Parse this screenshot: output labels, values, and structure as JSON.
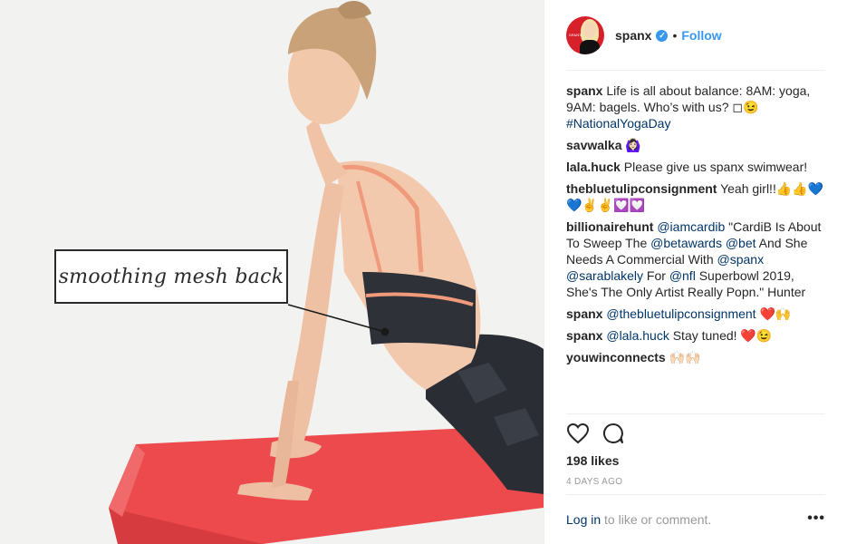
{
  "photo": {
    "callout_text": "smoothing mesh back"
  },
  "header": {
    "username": "spanx",
    "verified_icon": "verified-badge-icon",
    "separator": "•",
    "follow_label": "Follow",
    "avatar_brand": "SPANX"
  },
  "caption": {
    "username": "spanx",
    "text": " Life is all about balance: 8AM: yoga, 9AM: bagels. Who’s with us? ◻😉 ",
    "hashtag": "#NationalYogaDay"
  },
  "comments": [
    {
      "user": "savwalka",
      "parts": [
        " 🙆🏻‍♀️"
      ]
    },
    {
      "user": "lala.huck",
      "parts": [
        " Please give us spanx swimwear!"
      ]
    },
    {
      "user": "thebluetulipconsignment",
      "parts": [
        " Yeah girl!!👍👍💙💙✌✌💟💟"
      ]
    },
    {
      "user": "billionairehunt",
      "mention1": "@iamcardib",
      "t1": " \"CardiB Is About To Sweep The ",
      "mention2": "@betawards",
      "t2": " ",
      "mention3": "@bet",
      "t3": " And She Needs A Commercial With ",
      "mention4": "@spanx",
      "t4": " ",
      "mention5": "@sarablakely",
      "t5": " For ",
      "mention6": "@nfl",
      "t6": " Superbowl 2019, She's The Only Artist Really Popn.\" Hunter"
    },
    {
      "user": "spanx",
      "mention": "@thebluetulipconsignment",
      "text": " ❤️🙌"
    },
    {
      "user": "spanx",
      "mention": "@lala.huck",
      "text": " Stay tuned! ❤️😉"
    },
    {
      "user": "youwinconnects",
      "text": " 🙌🏻🙌🏻"
    }
  ],
  "actions": {
    "like_icon": "heart-icon",
    "comment_icon": "comment-icon"
  },
  "likes": "198 likes",
  "time_ago": "4 DAYS AGO",
  "footer": {
    "login_link": "Log in",
    "login_text": " to like or comment.",
    "more": "•••"
  },
  "colors": {
    "link": "#003569",
    "accent": "#3897f0",
    "mat": "#ec4a4c",
    "muted": "#999999"
  }
}
